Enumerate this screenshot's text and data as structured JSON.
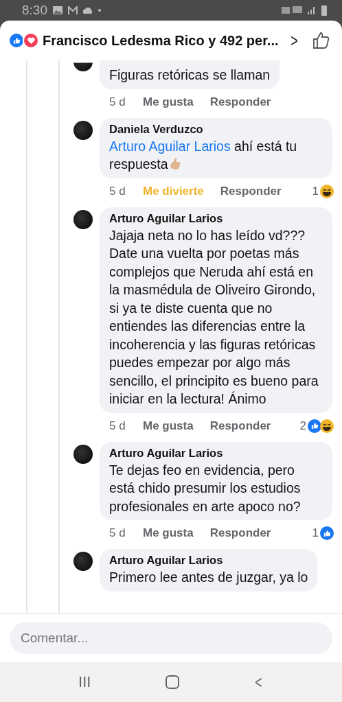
{
  "status_bar": {
    "time": "8:30"
  },
  "header": {
    "title": "Francisco Ledesma Rico y 492 per...",
    "reactions": [
      {
        "kind": "like"
      },
      {
        "kind": "love"
      }
    ],
    "chevron": ">"
  },
  "comments": [
    {
      "text": "Figuras retóricas se llaman",
      "time": "5 d",
      "reaction_label": "Me gusta",
      "reacted": false,
      "reply_label": "Responder",
      "emoji": false,
      "cut_top": true
    },
    {
      "author": "Daniela Verduzco",
      "mention": "Arturo Aguilar Larios",
      "text": " ahí está tu respuesta",
      "time": "5 d",
      "reaction_label": "Me divierte",
      "reacted": true,
      "reply_label": "Responder",
      "count": "1",
      "count_reactions": [
        {
          "kind": "haha"
        }
      ],
      "emoji": true,
      "cut_top": false
    },
    {
      "author": "Arturo Aguilar Larios",
      "text": "Jajaja neta no lo has leído vd??? Date una vuelta por poetas más complejos que Neruda ahí está en la masmédula de Oliveiro Girondo, si ya te diste cuenta que no entiendes las diferencias entre la incoherencia y las figuras retóricas puedes empezar por algo más sencillo, el principito es bueno para iniciar en la lectura! Ánimo",
      "time": "5 d",
      "reaction_label": "Me gusta",
      "reacted": false,
      "reply_label": "Responder",
      "count": "2",
      "count_reactions": [
        {
          "kind": "like"
        },
        {
          "kind": "haha"
        }
      ],
      "emoji": false,
      "cut_top": false
    },
    {
      "author": "Arturo Aguilar Larios",
      "text": "Te dejas feo en evidencia, pero está chido presumir los estudios profesionales en arte apoco no?",
      "time": "5 d",
      "reaction_label": "Me gusta",
      "reacted": false,
      "reply_label": "Responder",
      "count": "1",
      "count_reactions": [
        {
          "kind": "like"
        }
      ],
      "emoji": false,
      "cut_top": false
    },
    {
      "author": "Arturo Aguilar Larios",
      "text": "Primero lee antes de juzgar, ya lo",
      "emoji": false,
      "cut_top": false
    }
  ],
  "composer": {
    "placeholder": "Comentar..."
  },
  "nav": {
    "recents": "III",
    "back": "<"
  }
}
